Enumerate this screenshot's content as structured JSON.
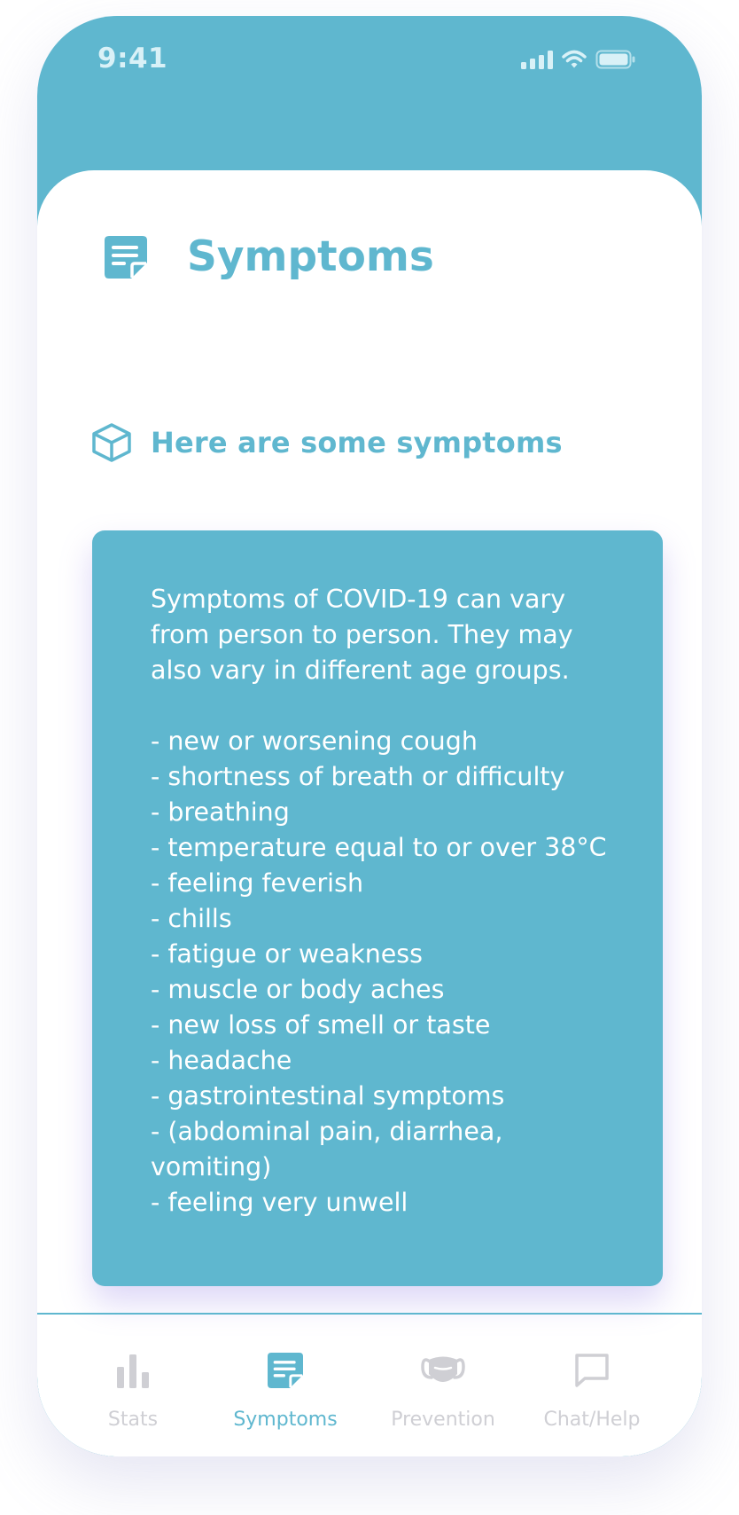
{
  "status_bar": {
    "time": "9:41"
  },
  "page": {
    "title": "Symptoms",
    "title_icon": "note-icon"
  },
  "section": {
    "title": "Here are some symptoms",
    "icon": "cube-icon"
  },
  "info_card": {
    "text": "Symptoms of COVID-19 can vary from person to person. They may also vary in different age groups.\n\n- new or worsening cough\n- shortness of breath or difficulty\n- breathing\n- temperature equal to or over 38°C\n- feeling feverish\n- chills\n- fatigue or weakness\n- muscle or body aches\n- new loss of smell or taste\n- headache\n- gastrointestinal symptoms\n- (abdominal pain, diarrhea, vomiting)\n- feeling very unwell"
  },
  "tabs": [
    {
      "label": "Stats",
      "icon": "bar-chart-icon",
      "active": false
    },
    {
      "label": "Symptoms",
      "icon": "note-icon",
      "active": true
    },
    {
      "label": "Prevention",
      "icon": "face-mask-icon",
      "active": false
    },
    {
      "label": "Chat/Help",
      "icon": "chat-bubble-icon",
      "active": false
    }
  ],
  "colors": {
    "accent": "#5fb7cf",
    "inactive": "#cfcfd4",
    "background": "#ffffff",
    "shadow": "#9682e6"
  }
}
